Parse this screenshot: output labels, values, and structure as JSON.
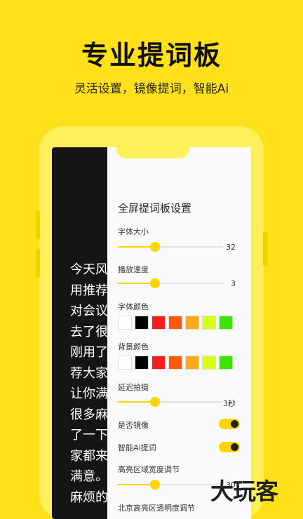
{
  "headline": "专业提词板",
  "subline": "灵活设置，镜像提词，智能Ai",
  "script_lines": [
    "今天风",
    "用推荐",
    "对会议",
    "去了很",
    "刚用了",
    "荐大家",
    "让你满",
    "很多麻",
    "了一下",
    "家都来",
    "满意。",
    "麻烦的"
  ],
  "panel": {
    "title": "全屏提词板设置",
    "font_size": {
      "label": "字体大小",
      "value": "32",
      "level": 0.35
    },
    "speed": {
      "label": "播放速度",
      "value": "3",
      "level": 0.35
    },
    "font_color": {
      "label": "字体颜色",
      "colors": [
        "#FFFFFF",
        "#000000",
        "#FF1A1A",
        "#FF5A0A",
        "#FFA91A",
        "#D7FF1A",
        "#3CE600"
      ]
    },
    "bg_color": {
      "label": "背景颜色",
      "colors": [
        "#FFFFFF",
        "#000000",
        "#FF1A1A",
        "#FF5A0A",
        "#FFA91A",
        "#D7FF1A",
        "#3CE600"
      ]
    },
    "delay": {
      "label": "延迟拍摄",
      "value": "3秒",
      "level": 0.35
    },
    "mirror": {
      "label": "是否镜像",
      "on": true
    },
    "smart_ai": {
      "label": "智能Ai提词",
      "on": true
    },
    "highlight_width": {
      "label": "高亮区域宽度调节",
      "value": "30",
      "level": 0.35
    },
    "highlight_opacity": {
      "label": "北京高亮区透明度调节"
    }
  },
  "watermark": "大玩客",
  "colors": {
    "accent": "#FFD400",
    "background": "#FFE01A"
  }
}
